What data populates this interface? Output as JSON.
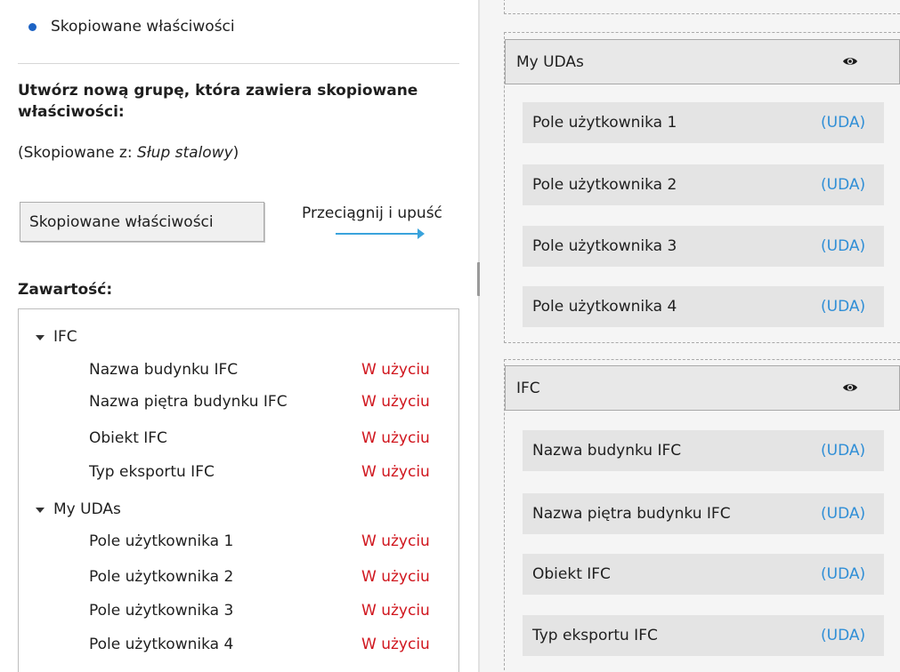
{
  "left_panel": {
    "radio_label": "Skopiowane właściwości",
    "heading": "Utwórz nową grupę, która zawiera skopiowane właściwości:",
    "copied_from_prefix": "(Skopiowane z: ",
    "copied_from_name": "Słup stalowy",
    "copied_from_suffix": ")",
    "group_button_label": "Skopiowane właściwości",
    "drag_drop_label": "Przeciągnij i upuść",
    "content_label": "Zawartość:",
    "tree": [
      {
        "label": "IFC",
        "items": [
          {
            "label": "Nazwa budynku IFC",
            "status": "W użyciu"
          },
          {
            "label": "Nazwa piętra budynku IFC",
            "status": "W użyciu"
          },
          {
            "label": "Obiekt IFC",
            "status": "W użyciu"
          },
          {
            "label": "Typ eksportu IFC",
            "status": "W użyciu"
          }
        ]
      },
      {
        "label": "My UDAs",
        "items": [
          {
            "label": "Pole użytkownika 1",
            "status": "W użyciu"
          },
          {
            "label": "Pole użytkownika 2",
            "status": "W użyciu"
          },
          {
            "label": "Pole użytkownika 3",
            "status": "W użyciu"
          },
          {
            "label": "Pole użytkownika 4",
            "status": "W użyciu"
          }
        ]
      }
    ]
  },
  "right_panel": {
    "sections": [
      {
        "title": "My UDAs",
        "icon": "eye-icon",
        "fields": [
          {
            "label": "Pole użytkownika 1",
            "tag": "(UDA)"
          },
          {
            "label": "Pole użytkownika 2",
            "tag": "(UDA)"
          },
          {
            "label": "Pole użytkownika 3",
            "tag": "(UDA)"
          },
          {
            "label": "Pole użytkownika 4",
            "tag": "(UDA)"
          }
        ]
      },
      {
        "title": "IFC",
        "icon": "eye-icon",
        "fields": [
          {
            "label": "Nazwa budynku IFC",
            "tag": "(UDA)"
          },
          {
            "label": "Nazwa piętra budynku IFC",
            "tag": "(UDA)"
          },
          {
            "label": "Obiekt IFC",
            "tag": "(UDA)"
          },
          {
            "label": "Typ eksportu IFC",
            "tag": "(UDA)"
          }
        ]
      }
    ]
  },
  "colors": {
    "status_in_use": "#d0161e",
    "uda_tag": "#2f8ed6",
    "radio_accent": "#1d63c4",
    "drag_arrow": "#3aa3dc"
  }
}
